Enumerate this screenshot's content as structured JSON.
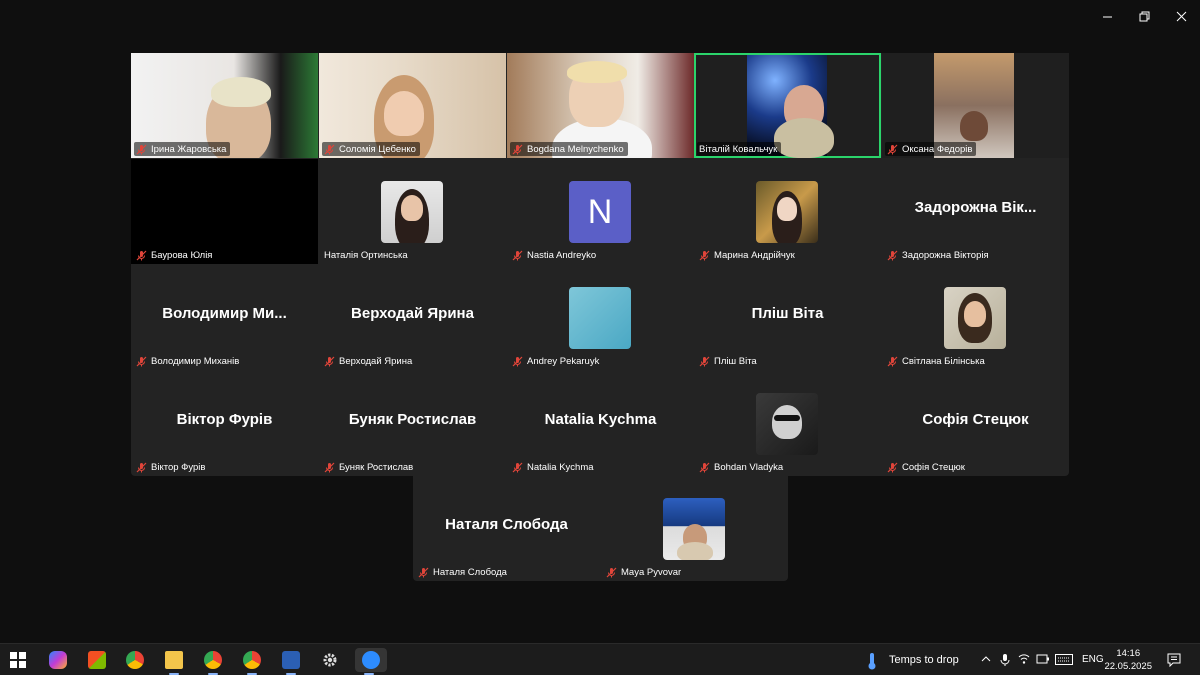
{
  "window": {
    "minimize_icon": "minimize-icon",
    "restore_icon": "restore-icon",
    "close_icon": "close-icon"
  },
  "participants": [
    {
      "name": "Ірина Жаровська",
      "kind": "video"
    },
    {
      "name": "Соломія Цебенко",
      "kind": "video"
    },
    {
      "name": "Bogdana Melnychenko",
      "kind": "video"
    },
    {
      "name": "Віталій Ковальчук",
      "kind": "video",
      "active_speaker": true
    },
    {
      "name": "Оксана Федорів",
      "kind": "video"
    },
    {
      "name": "Баурова Юлія",
      "kind": "black"
    },
    {
      "name": "Наталія Ортинська",
      "kind": "photo"
    },
    {
      "name": "Nastia Andreyko",
      "kind": "letter",
      "letter": "N"
    },
    {
      "name": "Марина Андрійчук",
      "kind": "photo"
    },
    {
      "name": "Задорожна Вікторія",
      "kind": "text",
      "display": "Задорожна  Вік..."
    },
    {
      "name": "Володимир Миханів",
      "kind": "text",
      "display": "Володимир  Ми..."
    },
    {
      "name": "Верходай Ярина",
      "kind": "text",
      "display": "Верходай Ярина"
    },
    {
      "name": "Andrey Pekaruyk",
      "kind": "photo"
    },
    {
      "name": "Пліш Віта",
      "kind": "text",
      "display": "Пліш Віта"
    },
    {
      "name": "Світлана Білінська",
      "kind": "photo"
    },
    {
      "name": "Віктор Фурів",
      "kind": "text",
      "display": "Віктор Фурів"
    },
    {
      "name": "Буняк Ростислав",
      "kind": "text",
      "display": "Буняк Ростислав"
    },
    {
      "name": "Natalia Kychma",
      "kind": "text",
      "display": "Natalia Kychma"
    },
    {
      "name": "Bohdan Vladyka",
      "kind": "photo"
    },
    {
      "name": "Софія Стецюк",
      "kind": "text",
      "display": "Софія Стецюк"
    },
    {
      "name": "Наталя Слобода",
      "kind": "text",
      "display": "Наталя Слобода"
    },
    {
      "name": "Maya Pyvovar",
      "kind": "photo"
    }
  ],
  "taskbar": {
    "weather": "Temps to drop",
    "language": "ENG",
    "time": "14:16",
    "date": "22.05.2025",
    "apps": [
      "windows-start-icon",
      "copilot-icon",
      "store-icon",
      "chrome-icon",
      "file-explorer-icon",
      "chrome-profile-icon",
      "chrome-profile-2-icon",
      "word-icon",
      "settings-icon",
      "zoom-icon"
    ]
  }
}
